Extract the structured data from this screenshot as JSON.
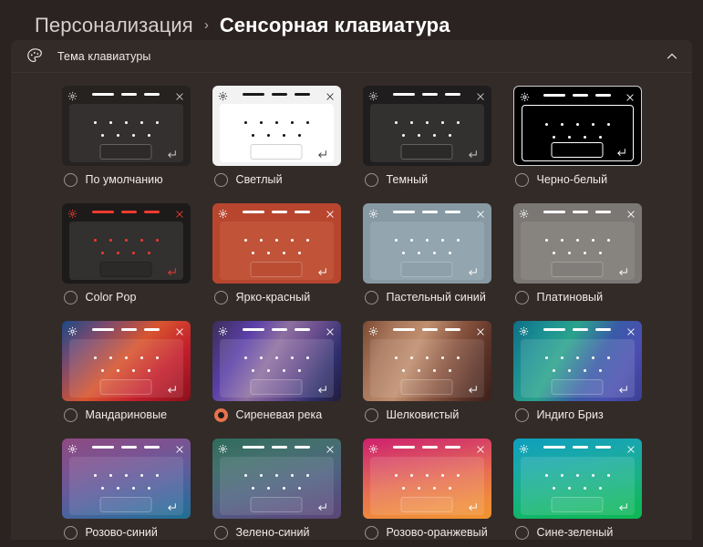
{
  "breadcrumb": {
    "parent": "Персонализация",
    "separator": "›",
    "current": "Сенсорная клавиатура"
  },
  "section": {
    "title": "Тема клавиатуры",
    "icon": "palette-icon",
    "collapse_icon": "chevron-up-icon",
    "expanded": true
  },
  "card_icons": {
    "settings": "gear-icon",
    "close": "close-icon",
    "enter": "enter-key-icon"
  },
  "colors": {
    "page_background": "#2b2321",
    "panel_background": "#332b28",
    "accent_selected": "#e8734c",
    "text_primary": "#f0ebe9",
    "text_heading": "#ffffff",
    "radio_border": "#9a9391"
  },
  "themes": [
    {
      "label": "По умолчанию",
      "selected": false,
      "outlined": false,
      "card_bg": "#262220",
      "kb_bg": "#343030",
      "key_bg": "#2e2a2a",
      "dot_color": "#ffffff",
      "dash_color": "#ffffff",
      "glyph_color": "#cfcbca"
    },
    {
      "label": "Светлый",
      "selected": false,
      "outlined": false,
      "card_bg": "#f2f2f2",
      "kb_bg": "#ffffff",
      "key_bg": "#ffffff",
      "dot_color": "#101010",
      "dash_color": "#1a1a1a",
      "glyph_color": "#3a3a3a"
    },
    {
      "label": "Темный",
      "selected": false,
      "outlined": false,
      "card_bg": "#1f1d1d",
      "kb_bg": "#333030",
      "key_bg": "#2c2929",
      "dot_color": "#ffffff",
      "dash_color": "#ffffff",
      "glyph_color": "#cfcbca"
    },
    {
      "label": "Черно-белый",
      "selected": false,
      "outlined": true,
      "card_bg": "#000000",
      "kb_bg": "#000000",
      "key_bg": "#000000",
      "dot_color": "#ffffff",
      "dash_color": "#ffffff",
      "glyph_color": "#ffffff"
    },
    {
      "label": "Color Pop",
      "selected": false,
      "outlined": false,
      "card_bg": "#1d1a1a",
      "kb_bg": "#333030",
      "key_bg": "#2c2929",
      "dot_color": "#ef3b2e",
      "dash_color": "#ef3b2e",
      "glyph_color": "#ef3b2e"
    },
    {
      "label": "Ярко-красный",
      "selected": false,
      "outlined": false,
      "card_bg": "#b8462f",
      "kb_bg": "#c05338",
      "key_bg": "#bb4d33",
      "dot_color": "#ffffff",
      "dash_color": "#ffffff",
      "glyph_color": "#ffffff"
    },
    {
      "label": "Пастельный синий",
      "selected": false,
      "outlined": false,
      "card_bg": "#879aa4",
      "kb_bg": "#93a5ae",
      "key_bg": "#8ea0aa",
      "dot_color": "#ffffff",
      "dash_color": "#ffffff",
      "glyph_color": "#ffffff"
    },
    {
      "label": "Платиновый",
      "selected": false,
      "outlined": false,
      "card_bg": "#7b7775",
      "kb_bg": "#87837f",
      "key_bg": "#817d7a",
      "dot_color": "#ffffff",
      "dash_color": "#ffffff",
      "glyph_color": "#ffffff"
    },
    {
      "label": "Мандариновые",
      "selected": false,
      "outlined": false,
      "card_bg": "linear-gradient(135deg,#1b4a86 0%,#7a4a6e 22%,#d8552f 48%,#c41f2c 72%,#8c0f1c 100%)",
      "kb_bg": "rgba(255,255,255,0.10)",
      "key_bg": "rgba(255,255,255,0.06)",
      "dot_color": "#ffffff",
      "dash_color": "#ffffff",
      "glyph_color": "#ffffff"
    },
    {
      "label": "Сиреневая река",
      "selected": true,
      "outlined": false,
      "card_bg": "linear-gradient(120deg,#3a2e58 0%,#5b3fa8 25%,#8d6fa0 45%,#6b4f8f 62%,#2f2f6e 82%,#201c3a 100%)",
      "kb_bg": "rgba(255,255,255,0.12)",
      "key_bg": "rgba(255,255,255,0.07)",
      "dot_color": "#ffffff",
      "dash_color": "#ffffff",
      "glyph_color": "#ffffff"
    },
    {
      "label": "Шелковистый",
      "selected": false,
      "outlined": false,
      "card_bg": "linear-gradient(115deg,#7a4a33 0%,#a8765a 20%,#c08f6f 40%,#8a5540 62%,#5c3328 82%,#3a2019 100%)",
      "kb_bg": "rgba(255,255,255,0.10)",
      "key_bg": "rgba(255,255,255,0.05)",
      "dot_color": "#ffffff",
      "dash_color": "#ffffff",
      "glyph_color": "#ffffff"
    },
    {
      "label": "Индиго Бриз",
      "selected": false,
      "outlined": false,
      "card_bg": "linear-gradient(120deg,#0f6e86 0%,#1b8f93 20%,#2aa38c 38%,#3a5aa8 62%,#4b4fb0 80%,#3b3f94 100%)",
      "kb_bg": "rgba(255,255,255,0.12)",
      "key_bg": "rgba(255,255,255,0.06)",
      "dot_color": "#ffffff",
      "dash_color": "#ffffff",
      "glyph_color": "#ffffff"
    },
    {
      "label": "Розово-синий",
      "selected": false,
      "outlined": false,
      "card_bg": "linear-gradient(165deg,#8e4a82 0%,#7b5392 30%,#5a5e9e 58%,#36699c 82%,#1f6f90 100%)",
      "kb_bg": "rgba(255,255,255,0.10)",
      "key_bg": "rgba(255,255,255,0.05)",
      "dot_color": "#ffffff",
      "dash_color": "#ffffff",
      "glyph_color": "#ffffff"
    },
    {
      "label": "Зелено-синий",
      "selected": false,
      "outlined": false,
      "card_bg": "linear-gradient(165deg,#2f6b5c 0%,#44706e 28%,#4f6480 55%,#57507f 80%,#5a4676 100%)",
      "kb_bg": "rgba(255,255,255,0.10)",
      "key_bg": "rgba(255,255,255,0.05)",
      "dot_color": "#ffffff",
      "dash_color": "#ffffff",
      "glyph_color": "#ffffff"
    },
    {
      "label": "Розово-оранжевый",
      "selected": false,
      "outlined": false,
      "card_bg": "linear-gradient(170deg,#cf1f6e 0%,#d94a63 28%,#e8714f 55%,#ef8a3c 80%,#f0932f 100%)",
      "kb_bg": "rgba(255,255,255,0.12)",
      "key_bg": "rgba(255,255,255,0.07)",
      "dot_color": "#ffffff",
      "dash_color": "#ffffff",
      "glyph_color": "#ffffff"
    },
    {
      "label": "Сине-зеленый",
      "selected": false,
      "outlined": false,
      "card_bg": "linear-gradient(170deg,#0e9fbf 0%,#19a9a8 30%,#17b285 58%,#10b664 82%,#0db755 100%)",
      "kb_bg": "rgba(255,255,255,0.12)",
      "key_bg": "rgba(255,255,255,0.07)",
      "dot_color": "#ffffff",
      "dash_color": "#ffffff",
      "glyph_color": "#ffffff"
    }
  ]
}
